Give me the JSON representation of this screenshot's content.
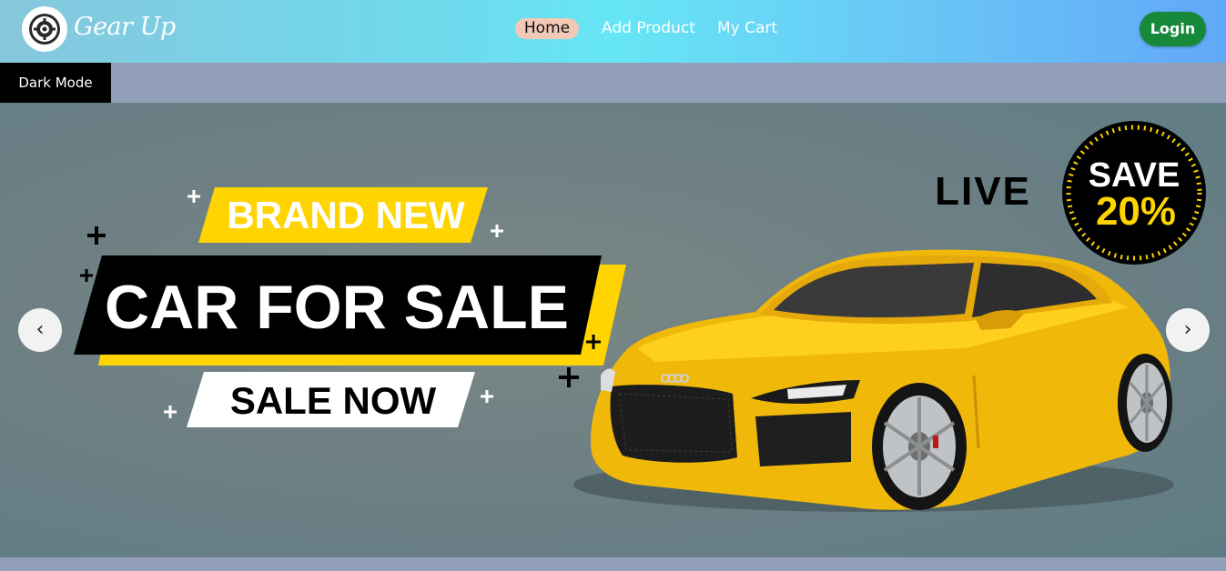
{
  "nav": {
    "logo_text": "Gear Up",
    "links": [
      "Home",
      "Add Product",
      "My Cart"
    ],
    "login_label": "Login"
  },
  "dark_mode_label": "Dark Mode",
  "carousel": {
    "prev_label": "‹",
    "next_label": "›",
    "banner": {
      "brand_new": "BRAND NEW",
      "car_for_sale": "CAR FOR SALE",
      "sale_now": "SALE NOW",
      "live": "LIVE",
      "save": "SAVE",
      "save_percent": "20%"
    }
  },
  "colors": {
    "accent_yellow": "#ffd400",
    "login_green": "#168a3a",
    "home_pill": "#f1c9b6"
  }
}
